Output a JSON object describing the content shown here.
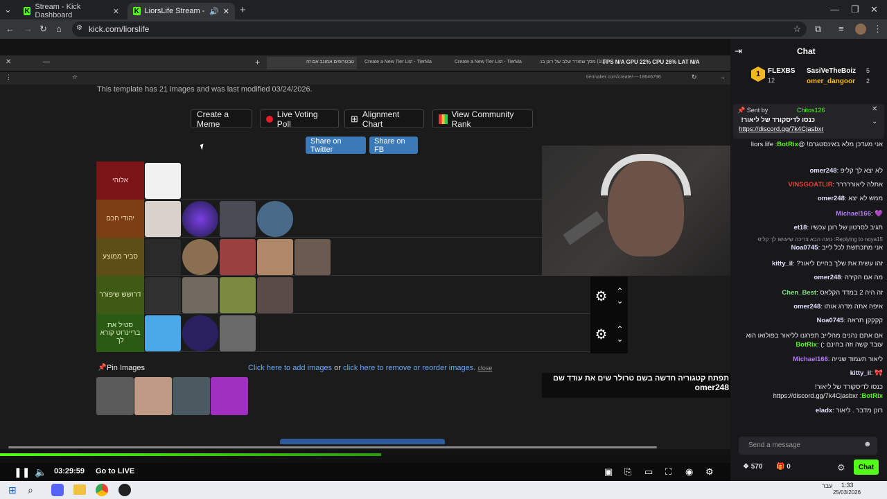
{
  "browser": {
    "tabs": [
      {
        "label": "Stream - Kick Dashboard",
        "active": false
      },
      {
        "label": "LiorsLife Stream - Watch Liv",
        "active": true
      }
    ],
    "url": "kick.com/liorslife"
  },
  "inner_browser": {
    "tabs": [
      "טבטרופים אמונב אם זה",
      "Create a New Tier List - TierMa",
      "Create a New Tier List - TierMa",
      "(10) מסך שפורר שלב של רונן בני"
    ],
    "url": "tiermaker.com/create/----18646796",
    "hud": "FPS N/A  GPU 22%  CPU 26%  LAT N/A"
  },
  "tiermaker": {
    "template_info": "This template has 21 images and was last modified 03/24/2026.",
    "buttons": {
      "meme": "Create a Meme",
      "poll": "Live Voting Poll",
      "alignment": "Alignment Chart",
      "community": "View Community Rank",
      "twitter": "Share on Twitter",
      "fb": "Share on FB"
    },
    "tiers": [
      {
        "label": "אלוהי",
        "color": "#7a1416",
        "text_color": "#ffd0d0"
      },
      {
        "label": "יהודי חכם",
        "color": "#7a3d14",
        "text_color": "#ffd8b0"
      },
      {
        "label": "סביר ממוצע",
        "color": "#5d4d16",
        "text_color": "#f0e2b0"
      },
      {
        "label": "דרושש שיפורר",
        "color": "#3f5a14",
        "text_color": "#e8f0c0"
      },
      {
        "label": "סטיל את בריינרוט קורא לך",
        "color": "#2a5a14",
        "text_color": "#d8f0c0"
      }
    ],
    "pin_images": "Pin Images",
    "add_link": "Click here to add images",
    "or": "or",
    "reorder_link": "click here to remove or reorder images.",
    "close": "close"
  },
  "stream_overlay": {
    "user": "omer248",
    "text": "תפתח קטגוריה חדשה בשם טרולר שים את עודד שם"
  },
  "player": {
    "time": "03:29:59",
    "go_live": "Go to LIVE"
  },
  "chat": {
    "title": "Chat",
    "leaders": [
      {
        "name": "FLEXBS",
        "count": "12"
      },
      {
        "name": "SasiVeTheBoiz",
        "count": "5"
      },
      {
        "name": "omer_dangoor",
        "count": "2"
      }
    ],
    "pinned": {
      "sent_by": "Sent by",
      "sender": "Chitos126",
      "text": "כנסו לדיסקורד של ליאור!",
      "link": "https://discord.gg/7k4Cjasbxr"
    },
    "messages": [
      {
        "user": "BotRix",
        "user_color": "#53fc18",
        "text": "אני מעדכן מלא באינסטגרם! @liors.life"
      },
      {
        "user": "omer248",
        "user_color": "#e0e0ff",
        "text": "לא יצא לך קליפ"
      },
      {
        "user": "VINSGOATLIR",
        "user_color": "#e0403a",
        "text": "אתלה ליאוררררר"
      },
      {
        "user": "omer248",
        "user_color": "#e0e0ff",
        "text": "ממש לא יצא"
      },
      {
        "user": "Michael166",
        "user_color": "#b57bff",
        "text": "💜"
      },
      {
        "user": "et18",
        "user_color": "#e0e0ff",
        "text": "תגיב לסרטון של רונן עכשיו"
      },
      {
        "user": "Noa0745",
        "user_color": "#e0e0ff",
        "text": "אני מתכתשת לכל לייב"
      },
      {
        "user": "kitty_il",
        "user_color": "#e0e0ff",
        "text": "זהו עשית את שלך בחיים ליאור?"
      },
      {
        "user": "omer248",
        "user_color": "#e0e0ff",
        "text": "מה אם הקירה"
      },
      {
        "user": "Chen_Best",
        "user_color": "#7fe07f",
        "text": "זה היה 2 במדד הקלאס"
      },
      {
        "user": "omer248",
        "user_color": "#e0e0ff",
        "text": "איפה אתה מדרג אותו"
      },
      {
        "user": "Noa0745",
        "user_color": "#e0e0ff",
        "text": "קקקקן תראה"
      },
      {
        "user": "BotRix",
        "user_color": "#53fc18",
        "text": "אם אתם נהנים מהלייב תפרגנו לליאור בפולואו הוא עובד קשה וזה בחינם :)"
      },
      {
        "user": "Michael166",
        "user_color": "#b57bff",
        "text": "ליאור תעמוד שנייה"
      },
      {
        "user": "kitty_il",
        "user_color": "#e0e0ff",
        "text": "🎀"
      },
      {
        "user": "BotRix",
        "user_color": "#53fc18",
        "text": "כנסו לדיסקורד של ליאור! https://discord.gg/7k4Cjasbxr"
      },
      {
        "user": "eladx",
        "user_color": "#e0e0ff",
        "text": "רונן מדבר . ליאור"
      }
    ],
    "reply_hint": "Replying to noya15: נועה הבא צריכה שיעושו לך קליפ",
    "input_placeholder": "Send a message",
    "points": "570",
    "gifts": "0",
    "send": "Chat"
  },
  "os": {
    "time": "1:33",
    "date": "25/03/2026",
    "lang": "עבר"
  },
  "colors": {
    "kick_green": "#53fc18",
    "blue": "#3b79b8"
  }
}
